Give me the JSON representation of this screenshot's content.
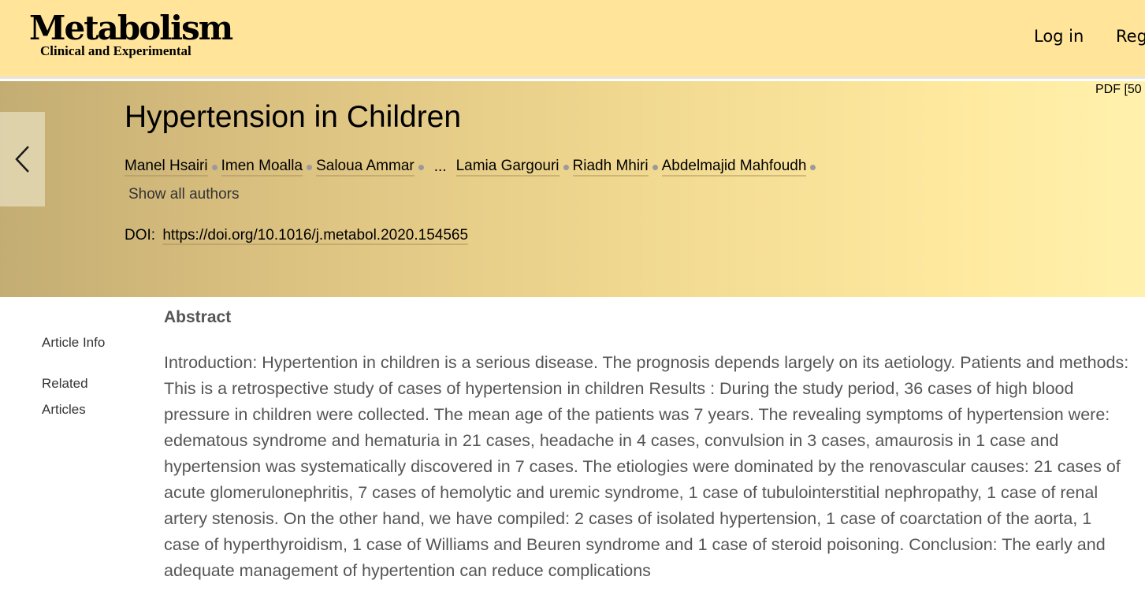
{
  "header": {
    "logo_title": "Metabolism",
    "logo_subtitle": "Clinical and Experimental",
    "login_label": "Log in",
    "register_label": "Reg"
  },
  "article": {
    "pdf_label": "PDF [50",
    "title": "Hypertension in Children",
    "authors": [
      "Manel Hsairi",
      "Imen Moalla",
      "Saloua Ammar",
      "Lamia Gargouri",
      "Riadh Mhiri",
      "Abdelmajid Mahfoudh"
    ],
    "authors_ellipsis": "...",
    "show_all_authors": "Show all authors",
    "doi_label": "DOI:",
    "doi_link": "https://doi.org/10.1016/j.metabol.2020.154565"
  },
  "sidebar": {
    "article_info": "Article Info",
    "related_articles": "Related Articles"
  },
  "abstract": {
    "heading": "Abstract",
    "text": "Introduction: Hypertention in children is a serious disease. The prognosis depends largely on its aetiology. Patients and methods: This is a retrospective study of cases of hypertension in children Results : During the study period, 36 cases of high blood pressure in children were collected. The mean age of the patients was 7 years. The revealing symptoms of hypertension were: edematous syndrome and hematuria in 21 cases, headache in 4 cases, convulsion in 3 cases, amaurosis in 1 case and hypertension was systematically discovered in 7 cases. The etiologies were dominated by the renovascular causes: 21 cases of acute glomerulonephritis, 7 cases of hemolytic and uremic syndrome, 1 case of tubulointerstitial nephropathy, 1 case of renal artery stenosis. On the other hand, we have compiled: 2 cases of isolated hypertension, 1 case of coarctation of the aorta, 1 case of hyperthyroidism, 1 case of Williams and Beuren syndrome and 1 case of steroid poisoning. Conclusion: The early and adequate management of hypertention can reduce complications"
  },
  "icons": {
    "back": "chevron-left-icon"
  }
}
